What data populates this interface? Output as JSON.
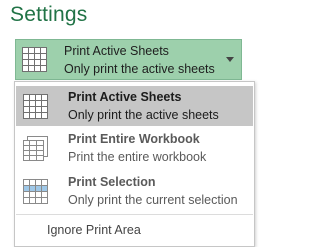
{
  "section": {
    "title": "Settings"
  },
  "dropdown": {
    "title": "Print Active Sheets",
    "description": "Only print the active sheets",
    "icon": "active-sheets-icon",
    "arrow_icon": "chevron-down-icon",
    "background_color": "#9dd0ac"
  },
  "menu": {
    "items": [
      {
        "title": "Print Active Sheets",
        "description": "Only print the active sheets",
        "icon": "active-sheets-icon",
        "selected": true
      },
      {
        "title": "Print Entire Workbook",
        "description": "Print the entire workbook",
        "icon": "entire-workbook-icon",
        "selected": false
      },
      {
        "title": "Print Selection",
        "description": "Only print the current selection",
        "icon": "selection-icon",
        "selected": false
      }
    ],
    "ignore_print_area": "Ignore Print Area",
    "selected_background": "#c6c6c6"
  },
  "colors": {
    "accent": "#217346"
  }
}
